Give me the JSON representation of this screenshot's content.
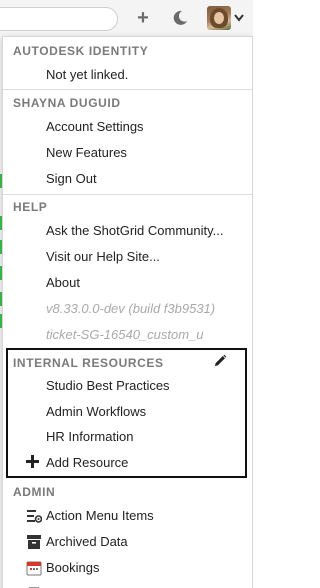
{
  "toolbar": {
    "plus_icon": "plus-icon",
    "moon_icon": "moon-icon",
    "avatar_caret_icon": "chevron-down-icon"
  },
  "menu": {
    "autodesk_identity": {
      "heading": "AUTODESK IDENTITY",
      "items": [
        "Not yet linked."
      ]
    },
    "user": {
      "heading": "SHAYNA DUGUID",
      "items": [
        "Account Settings",
        "New Features",
        "Sign Out"
      ]
    },
    "help": {
      "heading": "HELP",
      "items": [
        "Ask the ShotGrid Community...",
        "Visit our Help Site...",
        "About"
      ],
      "version": "v8.33.0.0-dev (build f3b9531)",
      "ticket": "ticket-SG-16540_custom_u"
    },
    "internal_resources": {
      "heading": "INTERNAL RESOURCES",
      "items": [
        "Studio Best Practices",
        "Admin Workflows",
        "HR Information"
      ],
      "add_label": "Add Resource"
    },
    "admin": {
      "heading": "ADMIN",
      "items": [
        "Action Menu Items",
        "Archived Data",
        "Bookings"
      ]
    }
  },
  "colors": {
    "accent_green": "#3bbf4a",
    "highlight_border": "#111111",
    "bookings_icon_red": "#d33a2c"
  }
}
